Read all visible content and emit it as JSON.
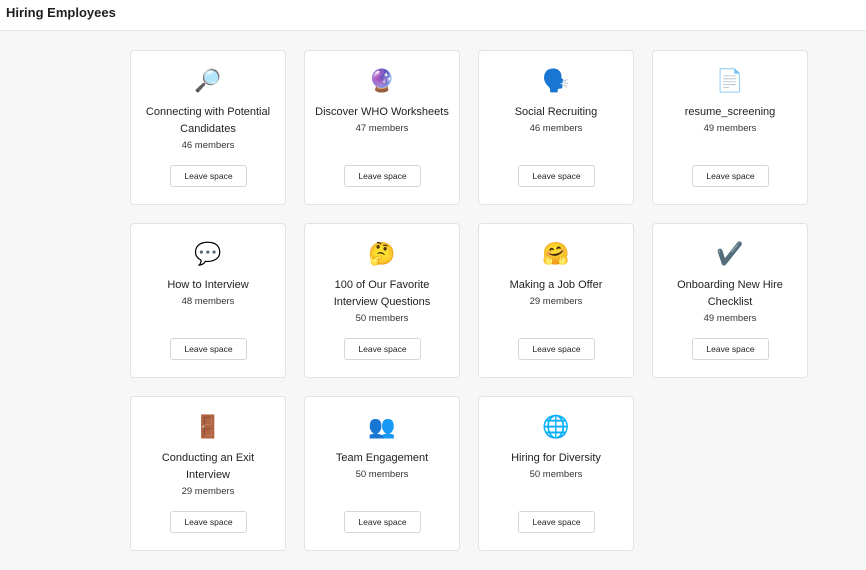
{
  "page": {
    "title": "Hiring Employees"
  },
  "leave_label": "Leave space",
  "spaces": [
    {
      "title": "Connecting with Potential Candidates",
      "members": "46 members",
      "icon": "magnifying-glass",
      "glyph": "🔎"
    },
    {
      "title": "Discover WHO Worksheets",
      "members": "47 members",
      "icon": "crystal-ball",
      "glyph": "🔮"
    },
    {
      "title": "Social Recruiting",
      "members": "46 members",
      "icon": "speaking-head",
      "glyph": "🗣️"
    },
    {
      "title": "resume_screening",
      "members": "49 members",
      "icon": "document-page",
      "glyph": "📄"
    },
    {
      "title": "How to Interview",
      "members": "48 members",
      "icon": "speech-bubble",
      "glyph": "💬"
    },
    {
      "title": "100 of Our Favorite Interview Questions",
      "members": "50 members",
      "icon": "thinking-face",
      "glyph": "🤔"
    },
    {
      "title": "Making a Job Offer",
      "members": "29 members",
      "icon": "hugging-face",
      "glyph": "🤗"
    },
    {
      "title": "Onboarding New Hire Checklist",
      "members": "49 members",
      "icon": "check-mark",
      "glyph": "✔️"
    },
    {
      "title": "Conducting an Exit Interview",
      "members": "29 members",
      "icon": "door",
      "glyph": "🚪"
    },
    {
      "title": "Team Engagement",
      "members": "50 members",
      "icon": "people",
      "glyph": "👥"
    },
    {
      "title": "Hiring for Diversity",
      "members": "50 members",
      "icon": "globe",
      "glyph": "🌐"
    }
  ]
}
